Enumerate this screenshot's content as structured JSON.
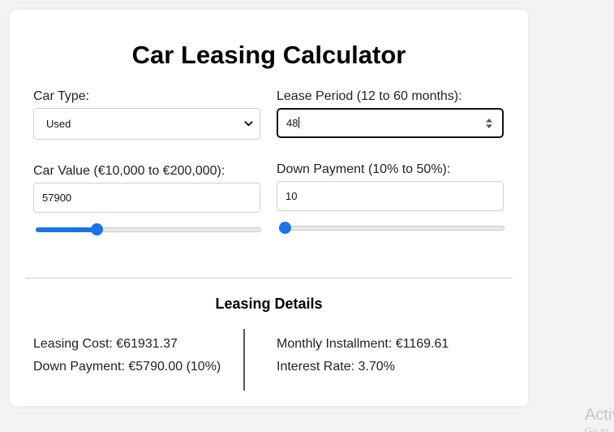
{
  "calculator": {
    "title": "Car Leasing Calculator",
    "car_type": {
      "label": "Car Type:",
      "selected": "Used"
    },
    "lease_period": {
      "label": "Lease Period (12 to 60 months):",
      "value": "48"
    },
    "car_value": {
      "label": "Car Value (€10,000 to €200,000):",
      "value": "57900",
      "slider_fraction": 0.2574
    },
    "down_payment": {
      "label": "Down Payment (10% to 50%):",
      "value": "10",
      "slider_fraction": 0.0
    }
  },
  "details": {
    "title": "Leasing Details",
    "leasing_cost": "Leasing Cost: €61931.37",
    "down_payment": "Down Payment: €5790.00 (10%)",
    "monthly_installment": "Monthly Installment: €1169.61",
    "interest_rate": "Interest Rate: 3.70%"
  },
  "watermark": {
    "line1": "Activ",
    "line2": "Go to"
  },
  "colors": {
    "accent": "#1a73e8",
    "background": "#f3f3f3",
    "card": "#ffffff"
  },
  "icons": {
    "select_arrow": "chevron-down-icon",
    "number_spinner": "spinner-arrows-icon"
  }
}
